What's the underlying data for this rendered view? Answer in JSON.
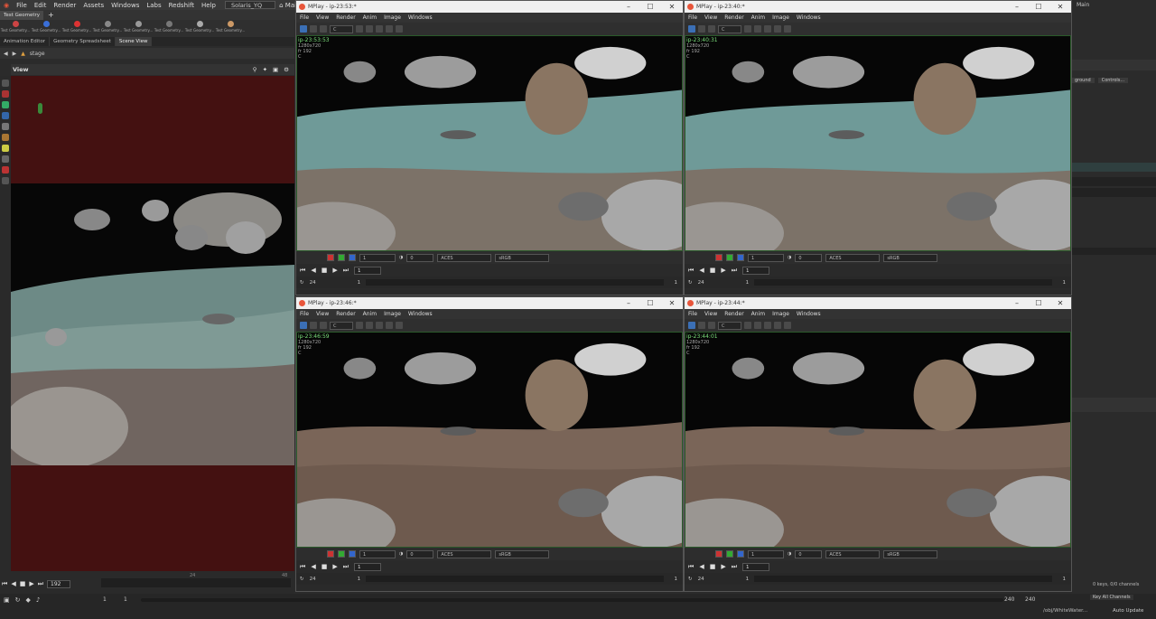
{
  "menubar": {
    "items": [
      "File",
      "Edit",
      "Render",
      "Assets",
      "Windows",
      "Labs",
      "Redshift",
      "Help"
    ],
    "desktop": "Solaris_YQ",
    "context": "Main"
  },
  "shelf": {
    "tab": "Test Geometry",
    "tools": [
      "Test Geometry...",
      "Test Geometry...",
      "Test Geometry...",
      "Test Geometry...",
      "Test Geometry...",
      "Test Geometry...",
      "Test Geometry...",
      "Test Geometry..."
    ]
  },
  "panetabs": [
    "Animation Editor",
    "Geometry Spreadsheet",
    "Scene View"
  ],
  "path": "stage",
  "view_label": "View",
  "timeline": {
    "frame": "192",
    "start": "1",
    "start2": "1",
    "end": "240",
    "end2": "240",
    "tick24": "24",
    "tick48": "48"
  },
  "status": {
    "obj_path": "/obj/WhiteWater...",
    "auto_update": "Auto Update",
    "keys": "0 keys, 0/0 channels",
    "key_all": "Key All Channels"
  },
  "rightcol": {
    "right_context": "Main",
    "bg_label": "ground",
    "controls_label": "Controls..."
  },
  "windows": [
    {
      "title": "MPlay - ip-23:53:*",
      "stamp": "ip-23:53:53",
      "res": "1280x720",
      "fr": "fr 192",
      "ch": "C",
      "frame": "1",
      "fps": "24",
      "gamma": "1",
      "exposure": "0",
      "lut": "ACES",
      "space": "sRGB",
      "end": "1",
      "menu": [
        "File",
        "View",
        "Render",
        "Anim",
        "Image",
        "Windows"
      ],
      "channel": "C",
      "tone": "muted"
    },
    {
      "title": "MPlay - ip-23:40:*",
      "stamp": "ip-23:40:31",
      "res": "1280x720",
      "fr": "fr 192",
      "ch": "C",
      "frame": "1",
      "fps": "24",
      "gamma": "1",
      "exposure": "0",
      "lut": "ACES",
      "space": "sRGB",
      "end": "1",
      "menu": [
        "File",
        "View",
        "Render",
        "Anim",
        "Image",
        "Windows"
      ],
      "channel": "C",
      "tone": "muted"
    },
    {
      "title": "MPlay - ip-23:46:*",
      "stamp": "ip-23:46:59",
      "res": "1280x720",
      "fr": "fr 192",
      "ch": "C",
      "frame": "1",
      "fps": "24",
      "gamma": "1",
      "exposure": "0",
      "lut": "ACES",
      "space": "sRGB",
      "end": "1",
      "menu": [
        "File",
        "View",
        "Render",
        "Anim",
        "Image",
        "Windows"
      ],
      "channel": "C",
      "tone": "brown"
    },
    {
      "title": "MPlay - ip-23:44:*",
      "stamp": "ip-23:44:01",
      "res": "1280x720",
      "fr": "fr 192",
      "ch": "C",
      "frame": "1",
      "fps": "24",
      "gamma": "1",
      "exposure": "0",
      "lut": "ACES",
      "space": "sRGB",
      "end": "1",
      "menu": [
        "File",
        "View",
        "Render",
        "Anim",
        "Image",
        "Windows"
      ],
      "channel": "C",
      "tone": "brown"
    }
  ],
  "colors": {
    "viewport_bg": "#441111",
    "accent": "#3b6fb5",
    "water": "#7fa9a4",
    "rock": "#8a7a68"
  }
}
